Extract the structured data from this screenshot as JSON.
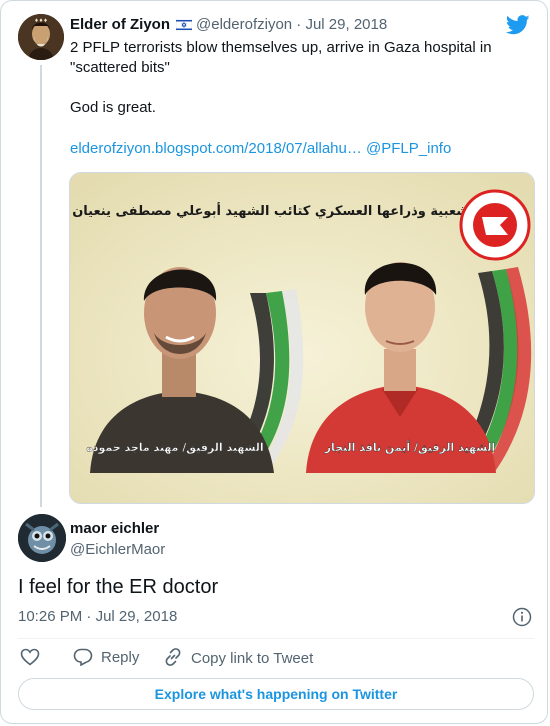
{
  "quoted_tweet": {
    "name": "Elder of Ziyon",
    "flag_icon": "israel-flag-icon",
    "handle": "@elderofziyon",
    "separator": "·",
    "date": "Jul 29, 2018",
    "text_line1": "2 PFLP terrorists blow themselves up, arrive in Gaza hospital in \"scattered bits\"",
    "text_line2": "God is great.",
    "link": "elderofziyon.blogspot.com/2018/07/allahu…",
    "mention": "@PFLP_info",
    "media": {
      "banner_text": "الجبهة الشعبية وذراعها العسكري كتائب الشهيد أبوعلي مصطفى ينعيان",
      "caption_left": "الشهيد الرفيق/ مهند ماجد حموده",
      "caption_right": "الشهيد الرفيق/ أيمن نافذ النجار",
      "logo": "pflp-logo"
    }
  },
  "reply": {
    "name": "maor eichler",
    "handle": "@EichlerMaor",
    "text": "I feel for the ER doctor",
    "time": "10:26 PM",
    "separator": "·",
    "date": "Jul 29, 2018"
  },
  "actions": {
    "like_icon": "heart-icon",
    "reply_label": "Reply",
    "reply_icon": "reply-icon",
    "copy_label": "Copy link to Tweet",
    "copy_icon": "link-icon",
    "info_icon": "info-icon"
  },
  "explore_label": "Explore what's happening on Twitter",
  "colors": {
    "link": "#1b95e0",
    "muted": "#536471",
    "twitter_blue": "#1d9bf0",
    "border": "#cfd9de"
  }
}
